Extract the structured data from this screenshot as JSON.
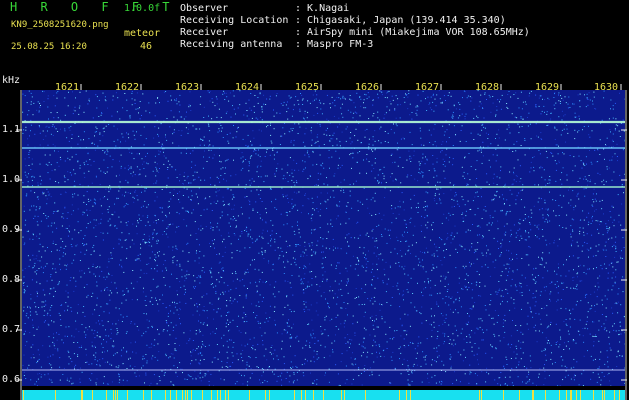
{
  "app": {
    "title": "H R O F F T",
    "version": "1.0.0f",
    "file_name": "KN9_2508251620.png",
    "timestamp": "25.08.25 16:20",
    "mode_label": "meteor",
    "mode_value": "46"
  },
  "info": [
    {
      "key": "Observer",
      "value": ": K.Nagai"
    },
    {
      "key": "Receiving Location",
      "value": ": Chigasaki, Japan (139.414 35.340)"
    },
    {
      "key": "Receiver",
      "value": ": AirSpy mini (Miakejima VOR 108.65MHz)"
    },
    {
      "key": "Receiving antenna",
      "value": ": Maspro FM-3"
    }
  ],
  "spectrogram": {
    "unit": "kHz",
    "y_ticks": [
      "1.1",
      "1.0",
      "0.9",
      "0.8",
      "0.7",
      "0.6"
    ],
    "x_ticks": [
      "1621",
      "1622",
      "1623",
      "1624",
      "1625",
      "1626",
      "1627",
      "1628",
      "1629",
      "1630"
    ],
    "colors": {
      "background": "#0c1a8c",
      "noise": "#2a8cff",
      "line": "#a8ffd0",
      "band": "#18e0f0"
    }
  }
}
